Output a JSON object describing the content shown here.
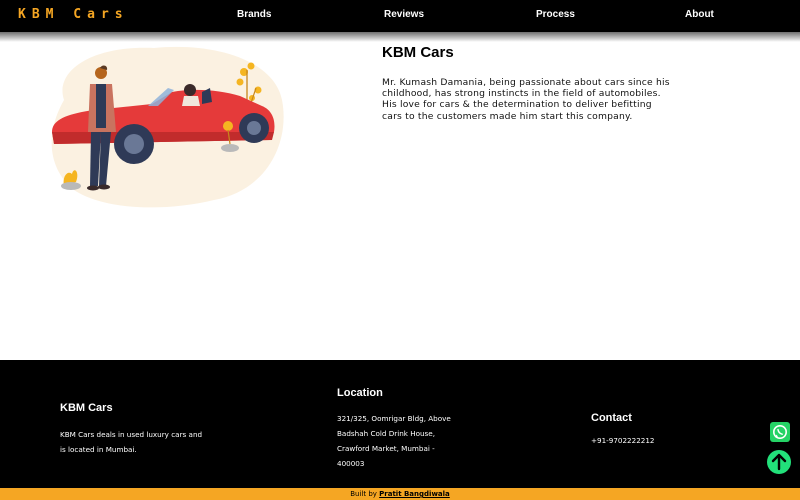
{
  "nav": {
    "logo": "KBM Cars",
    "links": [
      "Brands",
      "Reviews",
      "Process",
      "About"
    ]
  },
  "about": {
    "title": "KBM Cars",
    "text": "Mr. Kumash Damania, being passionate about cars since his childhood, has strong instincts in the field of automobiles. His love for cars & the determination to deliver befitting cars to the customers made him start this company."
  },
  "footer": {
    "brand_title": "KBM Cars",
    "brand_lines": [
      "KBM Cars deals in used luxury cars and",
      "is located in Mumbai."
    ],
    "location_title": "Location",
    "location_lines": [
      "321/325, Oomrigar Bldg, Above",
      "Badshah Cold Drink House,",
      "Crawford Market, Mumbai -",
      "400003"
    ],
    "contact_title": "Contact",
    "phone": "+91-9702222212"
  },
  "credit": {
    "prefix": "Built by ",
    "author": "Pratit Bangdiwala"
  },
  "icons": {
    "whatsapp": "whatsapp-icon",
    "back_to_top": "arrow-up-icon"
  },
  "colors": {
    "accent": "#f5a623",
    "nav_bg": "#000000",
    "footer_bg": "#000000",
    "whatsapp": "#25d366",
    "top_button": "#22e07a"
  }
}
